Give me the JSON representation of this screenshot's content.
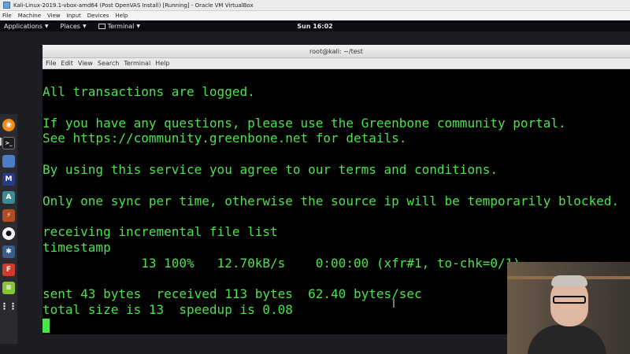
{
  "vbox": {
    "title": "Kali-Linux-2019.1-vbox-amd64 (Post OpenVAS Install) [Running] - Oracle VM VirtualBox",
    "menu": [
      "File",
      "Machine",
      "View",
      "Input",
      "Devices",
      "Help"
    ]
  },
  "panel": {
    "applications": "Applications",
    "places": "Places",
    "terminal": "Terminal",
    "clock": "Sun 16:02"
  },
  "dock": {
    "icons": [
      "firefox-icon",
      "terminal-icon",
      "files-icon",
      "metasploit-icon",
      "armitage-icon",
      "burpsuite-icon",
      "maltego-icon",
      "beef-icon",
      "faraday-icon",
      "leafpad-icon",
      "app-grid-icon"
    ],
    "colors": [
      "#f08a1c",
      "#1c1c1c",
      "#4a7ec5",
      "#2a3a8a",
      "#3f8a8f",
      "#b44b1f",
      "#f2f2f2",
      "#3a5c8c",
      "#d03b2b",
      "#8ac23a",
      "#ffffff"
    ]
  },
  "terminal": {
    "title": "root@kali: ~/test",
    "menu": [
      "File",
      "Edit",
      "View",
      "Search",
      "Terminal",
      "Help"
    ],
    "lines": [
      "All transactions are logged.",
      "",
      "If you have any questions, please use the Greenbone community portal.",
      "See https://community.greenbone.net for details.",
      "",
      "By using this service you agree to our terms and conditions.",
      "",
      "Only one sync per time, otherwise the source ip will be temporarily blocked.",
      "",
      "receiving incremental file list",
      "timestamp",
      "             13 100%   12.70kB/s    0:00:00 (xfr#1, to-chk=0/1)",
      "",
      "sent 43 bytes  received 113 bytes  62.40 bytes/sec",
      "total size is 13  speedup is 0.08"
    ],
    "text_color": "#4be34b",
    "background": "#000000"
  }
}
